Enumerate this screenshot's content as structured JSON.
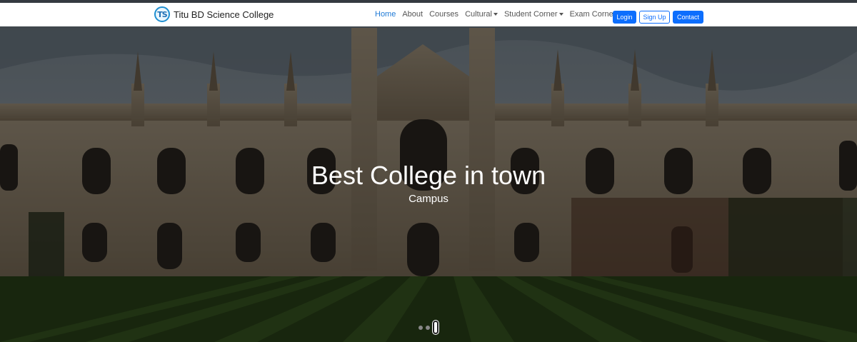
{
  "navbar": {
    "brand_logo_text": "TS",
    "brand_name": "Titu BD Science College",
    "links": {
      "home": "Home",
      "about": "About",
      "courses": "Courses",
      "cultural": "Cultural",
      "student_corner": "Student Corner",
      "exam_corner": "Exam Corner"
    },
    "buttons": {
      "login": "Login",
      "signup": "Sign Up",
      "contact": "Contact"
    }
  },
  "carousel": {
    "title": "Best College in town",
    "subtitle": "Campus",
    "slide_count": 3,
    "active_slide": 3
  },
  "colors": {
    "primary": "#0d6efd",
    "topbar": "#343a40"
  }
}
